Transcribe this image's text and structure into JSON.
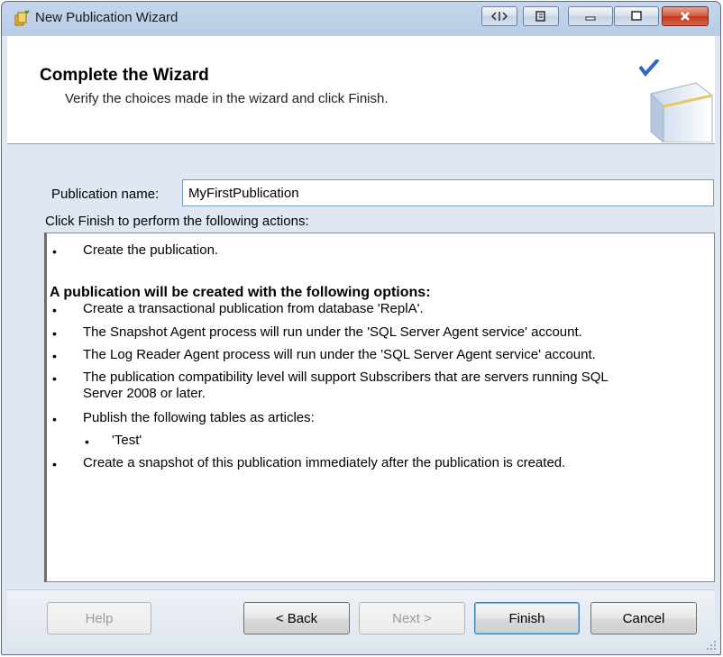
{
  "window": {
    "title": "New Publication Wizard",
    "controls": [
      "pin-icon",
      "restore-icon",
      "minimize-icon",
      "maximize-icon",
      "close-icon"
    ]
  },
  "header": {
    "title": "Complete the Wizard",
    "subtitle": "Verify the choices made in the wizard and click Finish."
  },
  "form": {
    "publication_label": "Publication name:",
    "publication_value": "MyFirstPublication",
    "instruction": "Click Finish to perform the following actions:"
  },
  "actions": {
    "first_item": "Create the publication.",
    "options_heading": "A publication will be created with the following options:",
    "items": [
      "Create a transactional publication from database 'ReplA'.",
      "The Snapshot Agent process will run under the 'SQL Server Agent service' account.",
      "The Log Reader Agent process will run under the 'SQL Server Agent service' account.",
      "The publication compatibility level will support Subscribers that are servers running SQL",
      "Publish the following tables as articles:",
      "Create a snapshot of this publication immediately after the publication is created."
    ],
    "item4_continued": "Server 2008 or later.",
    "article": "'Test'",
    "bullet": "•"
  },
  "buttons": {
    "help": "Help",
    "back": "< Back",
    "next": "Next >",
    "finish": "Finish",
    "cancel": "Cancel"
  }
}
